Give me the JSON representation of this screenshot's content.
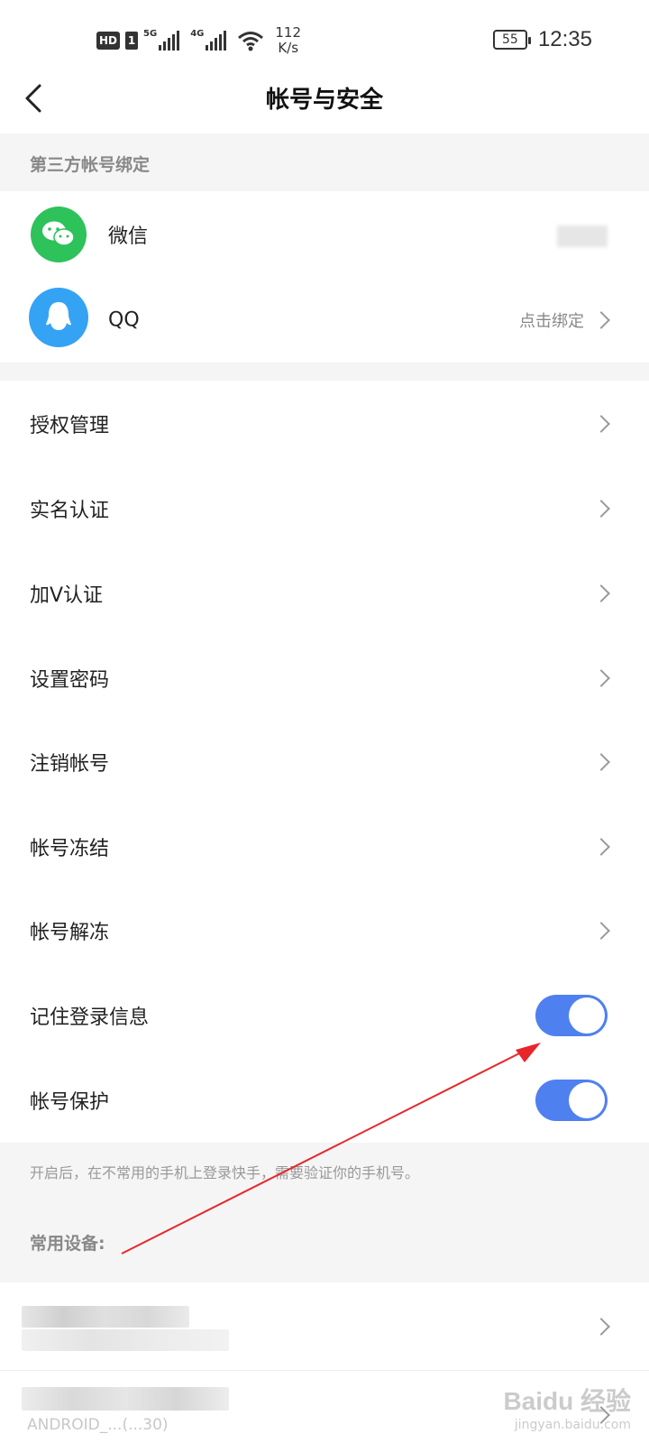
{
  "status_bar": {
    "hd": "HD",
    "sim": "1",
    "net1": "5G",
    "net2": "4G",
    "speed_value": "112",
    "speed_unit": "K/s",
    "battery": "55",
    "time": "12:35"
  },
  "navbar": {
    "title": "帐号与安全"
  },
  "third_party": {
    "section_title": "第三方帐号绑定",
    "wechat_label": "微信",
    "qq_label": "QQ",
    "qq_action": "点击绑定"
  },
  "menu": {
    "authorization": "授权管理",
    "real_name": "实名认证",
    "v_verify": "加V认证",
    "set_password": "设置密码",
    "cancel_account": "注销帐号",
    "freeze_account": "帐号冻结",
    "unfreeze_account": "帐号解冻",
    "remember_login": "记住登录信息",
    "account_protect": "帐号保护"
  },
  "toggles": {
    "remember_login_on": true,
    "account_protect_on": true,
    "accent_color": "#4f80f0"
  },
  "hint": "开启后，在不常用的手机上登录快手，需要验证你的手机号。",
  "devices": {
    "section_title": "常用设备:",
    "partial_text": "ANDROID_...(...30)"
  },
  "watermark": {
    "brand": "Baidu 经验",
    "url": "jingyan.baidu.com"
  }
}
